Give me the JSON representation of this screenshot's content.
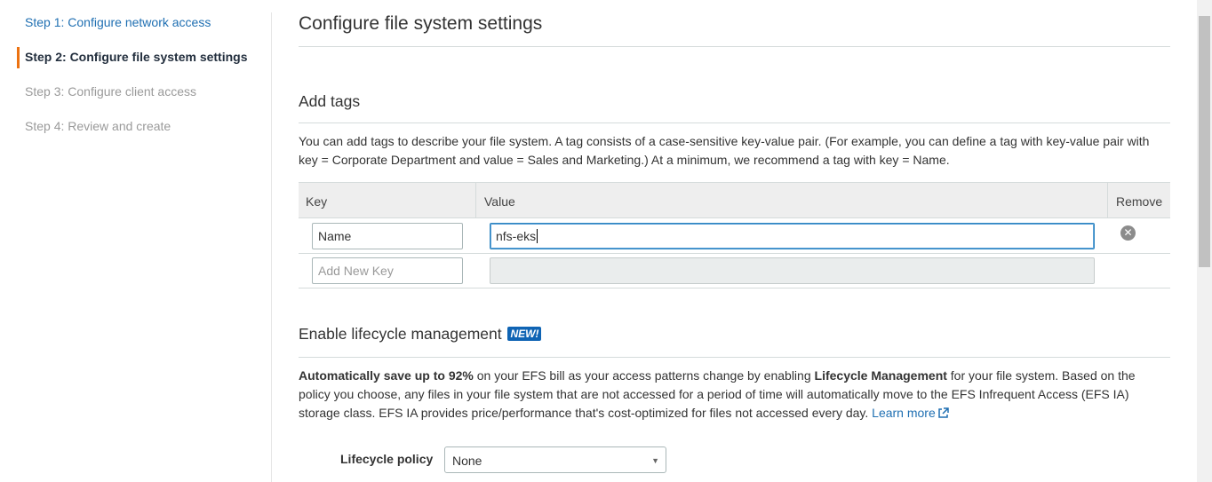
{
  "steps": [
    {
      "label": "Step 1: Configure network access",
      "state": "link"
    },
    {
      "label": "Step 2: Configure file system settings",
      "state": "active"
    },
    {
      "label": "Step 3: Configure client access",
      "state": "disabled"
    },
    {
      "label": "Step 4: Review and create",
      "state": "disabled"
    }
  ],
  "page": {
    "title": "Configure file system settings"
  },
  "tags": {
    "title": "Add tags",
    "description": "You can add tags to describe your file system. A tag consists of a case-sensitive key-value pair. (For example, you can define a tag with key-value pair with key = Corporate Department and value = Sales and Marketing.) At a minimum, we recommend a tag with key = Name.",
    "columns": {
      "key": "Key",
      "value": "Value",
      "remove": "Remove"
    },
    "rows": [
      {
        "key": "Name",
        "value": "nfs-eks"
      }
    ],
    "new_row": {
      "key_placeholder": "Add New Key",
      "value": ""
    }
  },
  "lifecycle": {
    "title": "Enable lifecycle management",
    "badge": "NEW!",
    "desc_bold1": "Automatically save up to 92%",
    "desc_text1": " on your EFS bill as your access patterns change by enabling ",
    "desc_bold2": "Lifecycle Management",
    "desc_text2": " for your file system. Based on the policy you choose, any files in your file system that are not accessed for a period of time will automatically move to the EFS Infrequent Access (EFS IA) storage class. EFS IA provides price/performance that's cost-optimized for files not accessed every day. ",
    "learn_more": "Learn more",
    "policy_label": "Lifecycle policy",
    "policy_value": "None"
  },
  "colors": {
    "accent": "#ec7211",
    "link": "#1f6fb2",
    "badge": "#0f64b4"
  }
}
